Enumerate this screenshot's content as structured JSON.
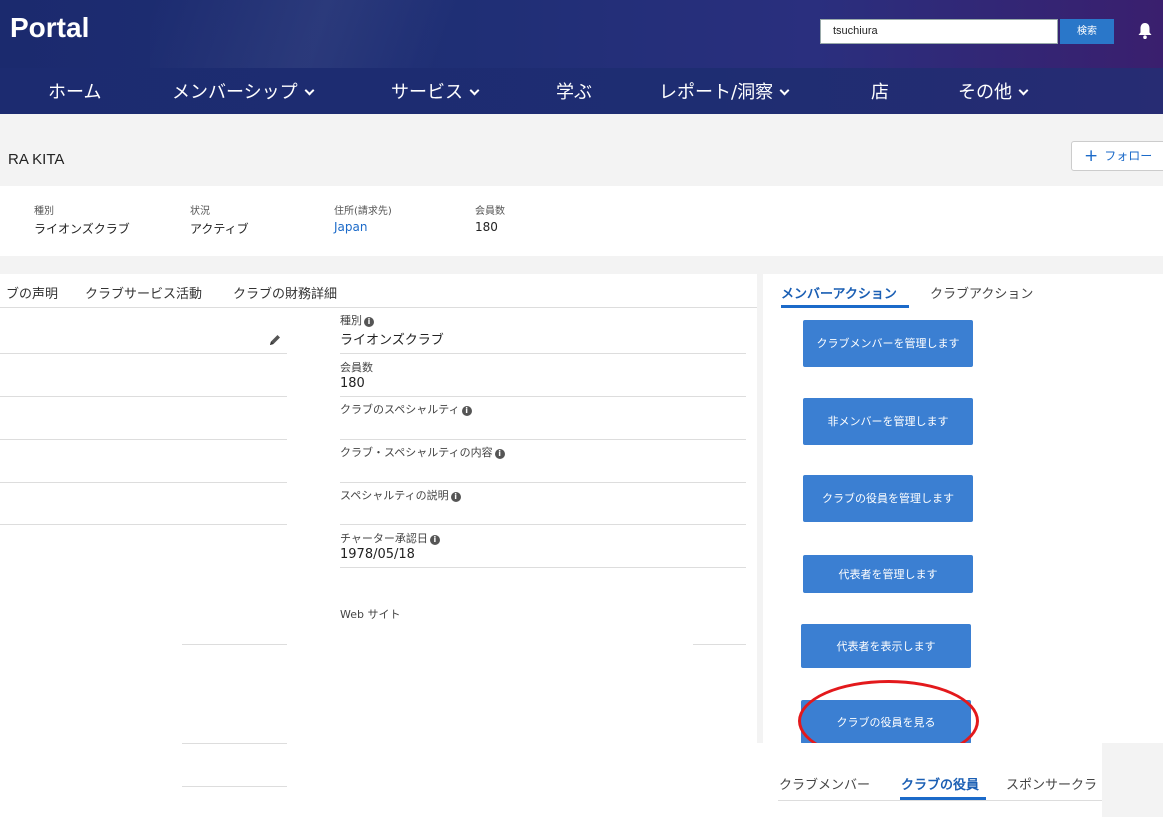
{
  "header": {
    "logo": "Portal",
    "search_value": "tsuchiura",
    "search_button": "検索",
    "bell_icon": "bell-icon"
  },
  "nav": {
    "items": [
      {
        "label": "ホーム",
        "dropdown": false
      },
      {
        "label": "メンバーシップ",
        "dropdown": true
      },
      {
        "label": "サービス",
        "dropdown": true
      },
      {
        "label": "学ぶ",
        "dropdown": false
      },
      {
        "label": "レポート/洞察",
        "dropdown": true
      },
      {
        "label": "店",
        "dropdown": false
      },
      {
        "label": "その他",
        "dropdown": true
      }
    ]
  },
  "record": {
    "title": "RA KITA",
    "follow_label": "フォロー"
  },
  "highlights": [
    {
      "label": "種別",
      "value": "ライオンズクラブ"
    },
    {
      "label": "状況",
      "value": "アクティブ"
    },
    {
      "label": "住所(請求先)",
      "value": "Japan"
    },
    {
      "label": "会員数",
      "value": "180"
    }
  ],
  "left_tabs": [
    "ブの声明",
    "クラブサービス活動",
    "クラブの財務詳細"
  ],
  "fields": [
    {
      "label": "種別",
      "value": "ライオンズクラブ",
      "info": true
    },
    {
      "label": "会員数",
      "value": "180",
      "info": false
    },
    {
      "label": "クラブのスペシャルティ",
      "value": "",
      "info": true
    },
    {
      "label": "クラブ・スペシャルティの内容",
      "value": "",
      "info": true
    },
    {
      "label": "スペシャルティの説明",
      "value": "",
      "info": true
    },
    {
      "label": "チャーター承認日",
      "value": "1978/05/18",
      "info": true
    },
    {
      "label": "Web サイト",
      "value": "",
      "info": false
    }
  ],
  "right_tabs": {
    "active": "メンバーアクション",
    "inactive": "クラブアクション"
  },
  "actions": [
    "クラブメンバーを管理します",
    "非メンバーを管理します",
    "クラブの役員を管理します",
    "代表者を管理します",
    "代表者を表示します",
    "クラブの役員を見る"
  ],
  "bottom_tabs": [
    "クラブメンバー",
    "クラブの役員",
    "スポンサークラ"
  ],
  "colors": {
    "header_bg": "#1c2b70",
    "accent": "#1b6ac9",
    "action_button": "#3b7fd2",
    "highlight_oval": "#e3191c"
  }
}
